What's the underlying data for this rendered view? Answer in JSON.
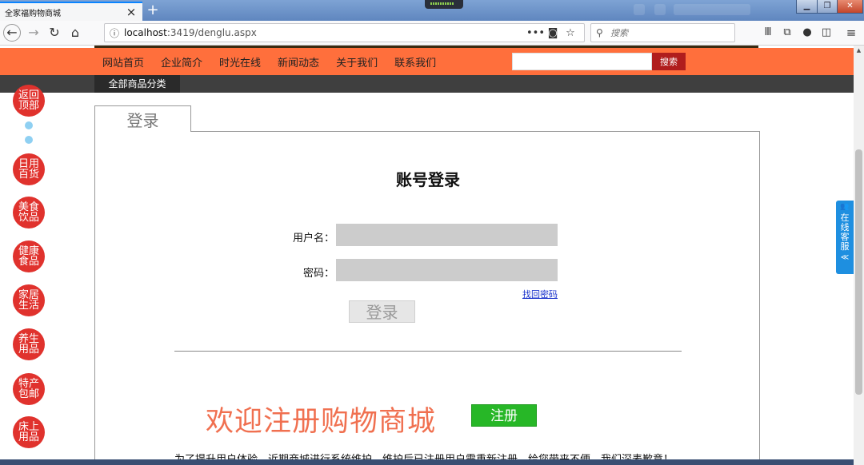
{
  "browser": {
    "tab_title": "全家福购物商城",
    "tab_close": "×",
    "new_tab": "+",
    "url_info_icon": "ⓘ",
    "url_host": "localhost",
    "url_rest": ":3419/denglu.aspx",
    "url_more": "•••",
    "search_placeholder": "搜索",
    "icons": [
      "back-icon",
      "forward-icon",
      "reload-icon",
      "home-icon",
      "pocket-icon",
      "bookmark-star-icon",
      "library-icon",
      "screenshot-icon",
      "chat-icon",
      "sidebar-icon",
      "menu-icon"
    ]
  },
  "header": {
    "nav_links": [
      "网站首页",
      "企业简介",
      "时光在线",
      "新闻动态",
      "关于我们",
      "联系我们"
    ],
    "search_button": "搜索",
    "search_value": "",
    "all_categories": "全部商品分类"
  },
  "sidebar": {
    "back_to_top": "返回顶部",
    "categories": [
      "日用百货",
      "美食饮品",
      "健康食品",
      "家居生活",
      "养生用品",
      "特产包邮",
      "床上用品"
    ]
  },
  "login": {
    "tab_label": "登录",
    "heading": "账号登录",
    "username_label": "用户名：",
    "username_value": "",
    "password_label": "密码：",
    "password_value": "",
    "forgot_link": "找回密码",
    "submit": "登录"
  },
  "register": {
    "welcome": "欢迎注册购物商城",
    "button": "注册",
    "notice": "为了提升用户体验，近期商城进行系统维护，维护后已注册用户需重新注册，给您带来不便，我们深表歉意！"
  },
  "service_widget": {
    "label": "在线客服",
    "collapse": "≪"
  },
  "colors": {
    "nav_orange": "#ff6f3c",
    "category_red": "#e0322d",
    "search_button_red": "#b01d1d",
    "register_green": "#27b727",
    "welcome_text": "#f07050",
    "service_blue": "#1e8fe0"
  }
}
